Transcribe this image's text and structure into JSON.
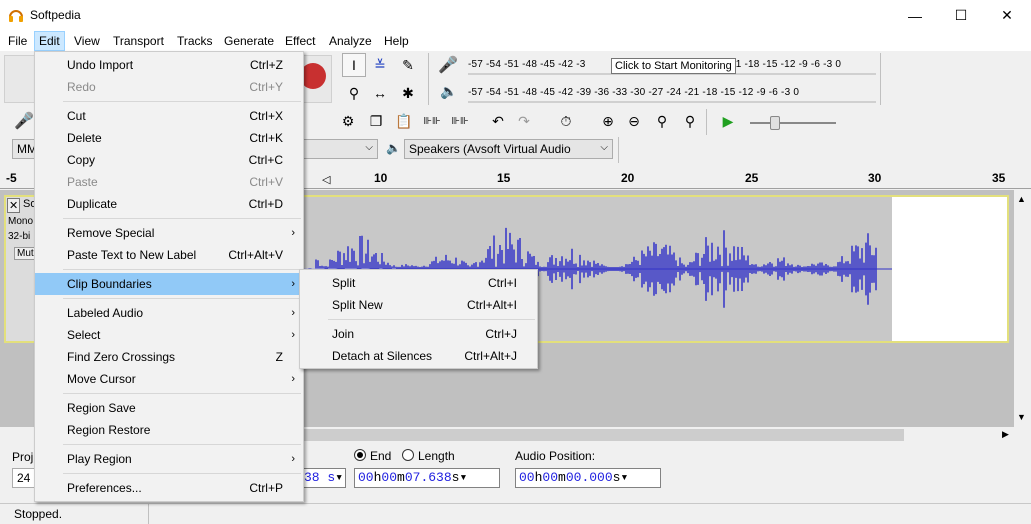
{
  "window": {
    "title": "Softpedia",
    "icon": "headphones-icon",
    "minimize": "—",
    "maximize": "☐",
    "close": "✕"
  },
  "menubar": {
    "items": [
      "File",
      "Edit",
      "View",
      "Transport",
      "Tracks",
      "Generate",
      "Effect",
      "Analyze",
      "Help"
    ]
  },
  "meters": {
    "record_ticks": "-57 -54 -51 -48 -45 -42 -3",
    "record_tooltip": "Click to Start Monitoring",
    "record_ticks_right": "21 -18 -15 -12  -9  -6  -3  0",
    "play_ticks": "-57 -54 -51 -48 -45 -42 -39 -36 -33 -30 -27 -24 -21 -18 -15 -12  -9  -6  -3  0"
  },
  "device": {
    "host_value": "MM",
    "output_device": "Speakers (Avsoft Virtual Audio"
  },
  "ruler": {
    "ticks": [
      "-5",
      "10",
      "15",
      "20",
      "25",
      "30",
      "35"
    ]
  },
  "track": {
    "close": "✕",
    "name": "So",
    "info1": "Mono",
    "info2": "32-bi",
    "mute": "Mut"
  },
  "watermark": "SOFTPEDIA",
  "selection": {
    "project_label": "Proj",
    "project_rate": "24",
    "end_label": "End",
    "length_label": "Length",
    "audio_position_label": "Audio Position:",
    "start_time": "38 s",
    "end_time": {
      "h": "00",
      "m": "00",
      "s": "07.638"
    },
    "audio_position": {
      "h": "00",
      "m": "00",
      "s": "00.000"
    }
  },
  "status": {
    "text": "Stopped."
  },
  "edit_menu": [
    {
      "label": "Undo Import",
      "shortcut": "Ctrl+Z"
    },
    {
      "label": "Redo",
      "shortcut": "Ctrl+Y",
      "disabled": true
    },
    {
      "label": "Cut",
      "shortcut": "Ctrl+X"
    },
    {
      "label": "Delete",
      "shortcut": "Ctrl+K"
    },
    {
      "label": "Copy",
      "shortcut": "Ctrl+C"
    },
    {
      "label": "Paste",
      "shortcut": "Ctrl+V",
      "disabled": true
    },
    {
      "label": "Duplicate",
      "shortcut": "Ctrl+D"
    },
    {
      "label": "Remove Special",
      "shortcut": ""
    },
    {
      "label": "Paste Text to New Label",
      "shortcut": "Ctrl+Alt+V"
    },
    {
      "label": "Clip Boundaries",
      "shortcut": ""
    },
    {
      "label": "Labeled Audio",
      "shortcut": ""
    },
    {
      "label": "Select",
      "shortcut": ""
    },
    {
      "label": "Find Zero Crossings",
      "shortcut": "Z"
    },
    {
      "label": "Move Cursor",
      "shortcut": ""
    },
    {
      "label": "Region Save",
      "shortcut": ""
    },
    {
      "label": "Region Restore",
      "shortcut": ""
    },
    {
      "label": "Play Region",
      "shortcut": ""
    },
    {
      "label": "Preferences...",
      "shortcut": "Ctrl+P"
    }
  ],
  "clip_menu": [
    {
      "label": "Split",
      "shortcut": "Ctrl+I"
    },
    {
      "label": "Split New",
      "shortcut": "Ctrl+Alt+I"
    },
    {
      "label": "Join",
      "shortcut": "Ctrl+J"
    },
    {
      "label": "Detach at Silences",
      "shortcut": "Ctrl+Alt+J"
    }
  ],
  "colors": {
    "waveform": "#3232c8",
    "menu_highlight": "#91c9f7",
    "track_border": "#e3e07c",
    "time_digits": "#2121e0"
  }
}
